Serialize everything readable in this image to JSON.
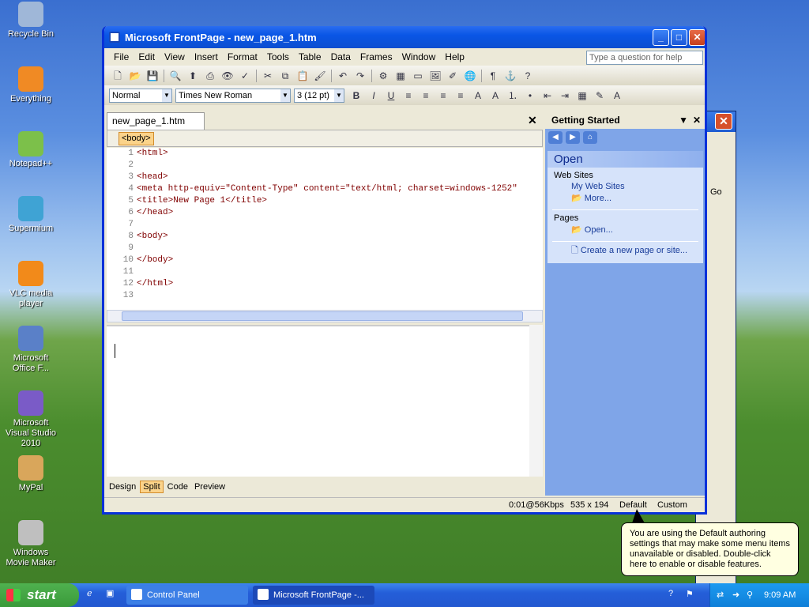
{
  "desktop": {
    "icons": [
      {
        "label": "Recycle Bin",
        "icon": "recycle-bin-icon",
        "color": "#9fb7d8"
      },
      {
        "label": "Everything",
        "icon": "search-magnifier-icon",
        "color": "#f08a24"
      },
      {
        "label": "Notepad++",
        "icon": "notepad-icon",
        "color": "#7cc04a"
      },
      {
        "label": "Supermium",
        "icon": "browser-globe-icon",
        "color": "#3fa3d4"
      },
      {
        "label": "VLC media player",
        "icon": "traffic-cone-icon",
        "color": "#f28a1a"
      },
      {
        "label": "Microsoft Office F...",
        "icon": "frontpage-shortcut-icon",
        "color": "#5a80c8"
      },
      {
        "label": "Microsoft Visual Studio 2010",
        "icon": "infinity-icon",
        "color": "#7a5bc7"
      },
      {
        "label": "MyPal",
        "icon": "bird-icon",
        "color": "#d9a65b"
      },
      {
        "label": "Windows Movie Maker",
        "icon": "film-reel-icon",
        "color": "#bfbfbf"
      }
    ]
  },
  "window": {
    "title": "Microsoft FrontPage - new_page_1.htm",
    "menus": [
      "File",
      "Edit",
      "View",
      "Insert",
      "Format",
      "Tools",
      "Table",
      "Data",
      "Frames",
      "Window",
      "Help"
    ],
    "ask_placeholder": "Type a question for help",
    "style_value": "Normal",
    "font_value": "Times New Roman",
    "size_value": "3  (12 pt)",
    "toolbar1_icons": [
      "new-page-icon",
      "open-folder-icon",
      "save-icon",
      "find-icon",
      "publish-icon",
      "print-icon",
      "preview-icon",
      "spelling-icon",
      "cut-icon",
      "copy-icon",
      "paste-icon",
      "format-painter-icon",
      "undo-icon",
      "redo-icon",
      "web-component-icon",
      "insert-table-icon",
      "layer-icon",
      "picture-icon",
      "drawing-icon",
      "hyperlink-icon",
      "show-all-icon",
      "bookmark-icon",
      "help-icon"
    ],
    "format_icons": [
      "bold-icon",
      "italic-icon",
      "underline-icon",
      "align-left-icon",
      "center-icon",
      "align-right-icon",
      "justify-icon",
      "grow-font-icon",
      "shrink-font-icon",
      "numbering-icon",
      "bullets-icon",
      "decrease-indent-icon",
      "increase-indent-icon",
      "borders-icon",
      "highlight-icon",
      "font-color-icon"
    ],
    "doc_tab": "new_page_1.htm",
    "tag_selector": "<body>",
    "code_lines": [
      {
        "n": "1",
        "t": "<html>"
      },
      {
        "n": "2",
        "t": ""
      },
      {
        "n": "3",
        "t": "<head>"
      },
      {
        "n": "4",
        "t": "<meta http-equiv=\"Content-Type\" content=\"text/html; charset=windows-1252\""
      },
      {
        "n": "5",
        "t": "<title>New Page 1</title>"
      },
      {
        "n": "6",
        "t": "</head>"
      },
      {
        "n": "7",
        "t": ""
      },
      {
        "n": "8",
        "t": "<body>"
      },
      {
        "n": "9",
        "t": ""
      },
      {
        "n": "10",
        "t": "</body>"
      },
      {
        "n": "11",
        "t": ""
      },
      {
        "n": "12",
        "t": "</html>"
      },
      {
        "n": "13",
        "t": ""
      }
    ],
    "view_tabs": [
      {
        "label": "Design",
        "active": false
      },
      {
        "label": "Split",
        "active": true
      },
      {
        "label": "Code",
        "active": false
      },
      {
        "label": "Preview",
        "active": false
      }
    ],
    "status": {
      "download": "0:01@56Kbps",
      "dims": "535 x 194",
      "mode": "Default",
      "custom": "Custom"
    }
  },
  "task_pane": {
    "title": "Getting Started",
    "section": "Open",
    "web_sites_label": "Web Sites",
    "my_web_sites": "My Web Sites",
    "more": "More...",
    "pages_label": "Pages",
    "open_link": "Open...",
    "create_link": "Create a new page or site..."
  },
  "background_window": {
    "go_label": "Go"
  },
  "tooltip": "You are using the Default authoring settings that may make some menu items unavailable or disabled.  Double-click here to enable or disable features.",
  "taskbar": {
    "start": "start",
    "tasks": [
      {
        "label": "Control Panel",
        "active": false
      },
      {
        "label": "Microsoft FrontPage -...",
        "active": true
      }
    ],
    "clock": "9:09 AM"
  },
  "colors": {
    "titlebar": "#0a56e6",
    "taskbar": "#245ed8",
    "start": "#3a9a3a",
    "pane": "#7fa5e8",
    "tag": "#fbd38a",
    "tooltip": "#ffffe1"
  }
}
